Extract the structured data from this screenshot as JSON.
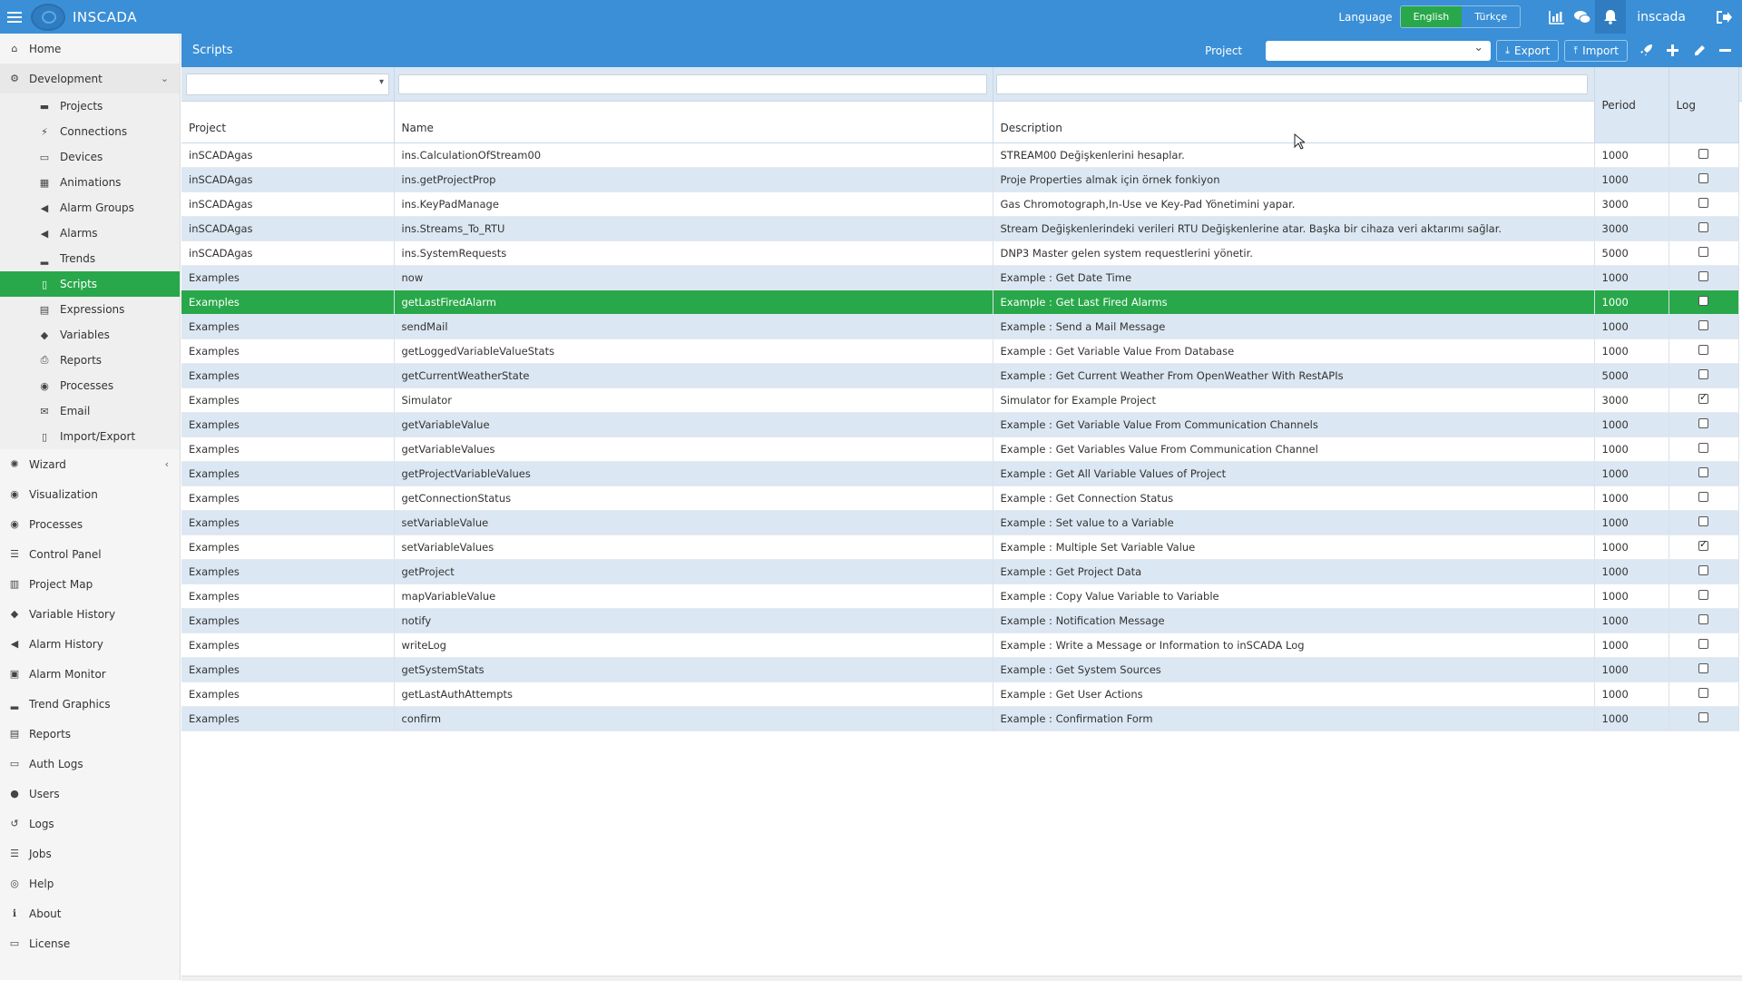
{
  "app": {
    "brand": "INSCADA",
    "language_label": "Language",
    "lang_en": "English",
    "lang_tr": "Türkçe",
    "user": "inscada"
  },
  "sidebar": {
    "top": [
      {
        "label": "Home",
        "icon": "home-icon"
      },
      {
        "label": "Development",
        "icon": "gear-icon"
      }
    ],
    "dev_items": [
      {
        "label": "Projects",
        "icon": "briefcase-icon"
      },
      {
        "label": "Connections",
        "icon": "plug-icon"
      },
      {
        "label": "Devices",
        "icon": "monitor-icon"
      },
      {
        "label": "Animations",
        "icon": "film-icon"
      },
      {
        "label": "Alarm Groups",
        "icon": "bullhorn-icon"
      },
      {
        "label": "Alarms",
        "icon": "bullhorn-icon"
      },
      {
        "label": "Trends",
        "icon": "signal-icon"
      },
      {
        "label": "Scripts",
        "icon": "file-icon"
      },
      {
        "label": "Expressions",
        "icon": "file-code-icon"
      },
      {
        "label": "Variables",
        "icon": "tags-icon"
      },
      {
        "label": "Reports",
        "icon": "print-icon"
      },
      {
        "label": "Processes",
        "icon": "circle-dot-icon"
      },
      {
        "label": "Email",
        "icon": "envelope-icon"
      },
      {
        "label": "Import/Export",
        "icon": "file-icon"
      }
    ],
    "bottom": [
      {
        "label": "Wizard",
        "icon": "rebel-icon"
      },
      {
        "label": "Visualization",
        "icon": "circle-dot-icon"
      },
      {
        "label": "Processes",
        "icon": "circle-dot-icon"
      },
      {
        "label": "Control Panel",
        "icon": "list-icon"
      },
      {
        "label": "Project Map",
        "icon": "map-icon"
      },
      {
        "label": "Variable History",
        "icon": "tags-icon"
      },
      {
        "label": "Alarm History",
        "icon": "bullhorn-icon"
      },
      {
        "label": "Alarm Monitor",
        "icon": "window-icon"
      },
      {
        "label": "Trend Graphics",
        "icon": "signal-icon"
      },
      {
        "label": "Reports",
        "icon": "file-text-icon"
      },
      {
        "label": "Auth Logs",
        "icon": "id-card-icon"
      },
      {
        "label": "Users",
        "icon": "user-icon"
      },
      {
        "label": "Logs",
        "icon": "history-icon"
      },
      {
        "label": "Jobs",
        "icon": "list-icon"
      },
      {
        "label": "Help",
        "icon": "life-ring-icon"
      },
      {
        "label": "About",
        "icon": "info-icon"
      },
      {
        "label": "License",
        "icon": "id-card-icon"
      }
    ]
  },
  "main": {
    "title": "Scripts",
    "project_label": "Project",
    "export_label": "Export",
    "import_label": "Import"
  },
  "table": {
    "headers": {
      "project": "Project",
      "name": "Name",
      "description": "Description",
      "period": "Period",
      "log": "Log"
    },
    "rows": [
      {
        "project": "inSCADAgas",
        "name": "ins.CalculationOfStream00",
        "description": "STREAM00 Değişkenlerini hesaplar.",
        "period": "1000",
        "log": false
      },
      {
        "project": "inSCADAgas",
        "name": "ins.getProjectProp",
        "description": "Proje Properties almak için örnek fonkiyon",
        "period": "1000",
        "log": false
      },
      {
        "project": "inSCADAgas",
        "name": "ins.KeyPadManage",
        "description": "Gas Chromotograph,In-Use ve Key-Pad Yönetimini yapar.",
        "period": "3000",
        "log": false
      },
      {
        "project": "inSCADAgas",
        "name": "ins.Streams_To_RTU",
        "description": "Stream Değişkenlerindeki verileri RTU Değişkenlerine atar. Başka bir cihaza veri aktarımı sağlar.",
        "period": "3000",
        "log": false
      },
      {
        "project": "inSCADAgas",
        "name": "ins.SystemRequests",
        "description": "DNP3 Master gelen system requestlerini yönetir.",
        "period": "5000",
        "log": false
      },
      {
        "project": "Examples",
        "name": "now",
        "description": "Example : Get Date Time",
        "period": "1000",
        "log": false
      },
      {
        "project": "Examples",
        "name": "getLastFiredAlarm",
        "description": "Example : Get Last Fired Alarms",
        "period": "1000",
        "log": false
      },
      {
        "project": "Examples",
        "name": "sendMail",
        "description": "Example : Send a Mail Message",
        "period": "1000",
        "log": false
      },
      {
        "project": "Examples",
        "name": "getLoggedVariableValueStats",
        "description": "Example : Get Variable Value From Database",
        "period": "1000",
        "log": false
      },
      {
        "project": "Examples",
        "name": "getCurrentWeatherState",
        "description": "Example : Get Current Weather From OpenWeather With RestAPIs",
        "period": "5000",
        "log": false
      },
      {
        "project": "Examples",
        "name": "Simulator",
        "description": "Simulator for Example Project",
        "period": "3000",
        "log": true
      },
      {
        "project": "Examples",
        "name": "getVariableValue",
        "description": "Example : Get Variable Value From Communication Channels",
        "period": "1000",
        "log": false
      },
      {
        "project": "Examples",
        "name": "getVariableValues",
        "description": "Example : Get Variables Value From Communication Channel",
        "period": "1000",
        "log": false
      },
      {
        "project": "Examples",
        "name": "getProjectVariableValues",
        "description": "Example : Get All Variable Values of Project",
        "period": "1000",
        "log": false
      },
      {
        "project": "Examples",
        "name": "getConnectionStatus",
        "description": "Example : Get Connection Status",
        "period": "1000",
        "log": false
      },
      {
        "project": "Examples",
        "name": "setVariableValue",
        "description": "Example : Set value to a Variable",
        "period": "1000",
        "log": false
      },
      {
        "project": "Examples",
        "name": "setVariableValues",
        "description": "Example : Multiple Set Variable Value",
        "period": "1000",
        "log": true
      },
      {
        "project": "Examples",
        "name": "getProject",
        "description": "Example : Get Project Data",
        "period": "1000",
        "log": false
      },
      {
        "project": "Examples",
        "name": "mapVariableValue",
        "description": "Example : Copy Value Variable to Variable",
        "period": "1000",
        "log": false
      },
      {
        "project": "Examples",
        "name": "notify",
        "description": "Example : Notification Message",
        "period": "1000",
        "log": false
      },
      {
        "project": "Examples",
        "name": "writeLog",
        "description": "Example : Write a Message or Information to inSCADA Log",
        "period": "1000",
        "log": false
      },
      {
        "project": "Examples",
        "name": "getSystemStats",
        "description": "Example : Get System Sources",
        "period": "1000",
        "log": false
      },
      {
        "project": "Examples",
        "name": "getLastAuthAttempts",
        "description": "Example : Get User Actions",
        "period": "1000",
        "log": false
      },
      {
        "project": "Examples",
        "name": "confirm",
        "description": "Example : Confirmation Form",
        "period": "1000",
        "log": false
      }
    ],
    "selected_index": 6
  },
  "colors": {
    "accent_blue": "#3a8fd6",
    "active_green": "#28a84a",
    "row_alt": "#dbe7f2"
  }
}
